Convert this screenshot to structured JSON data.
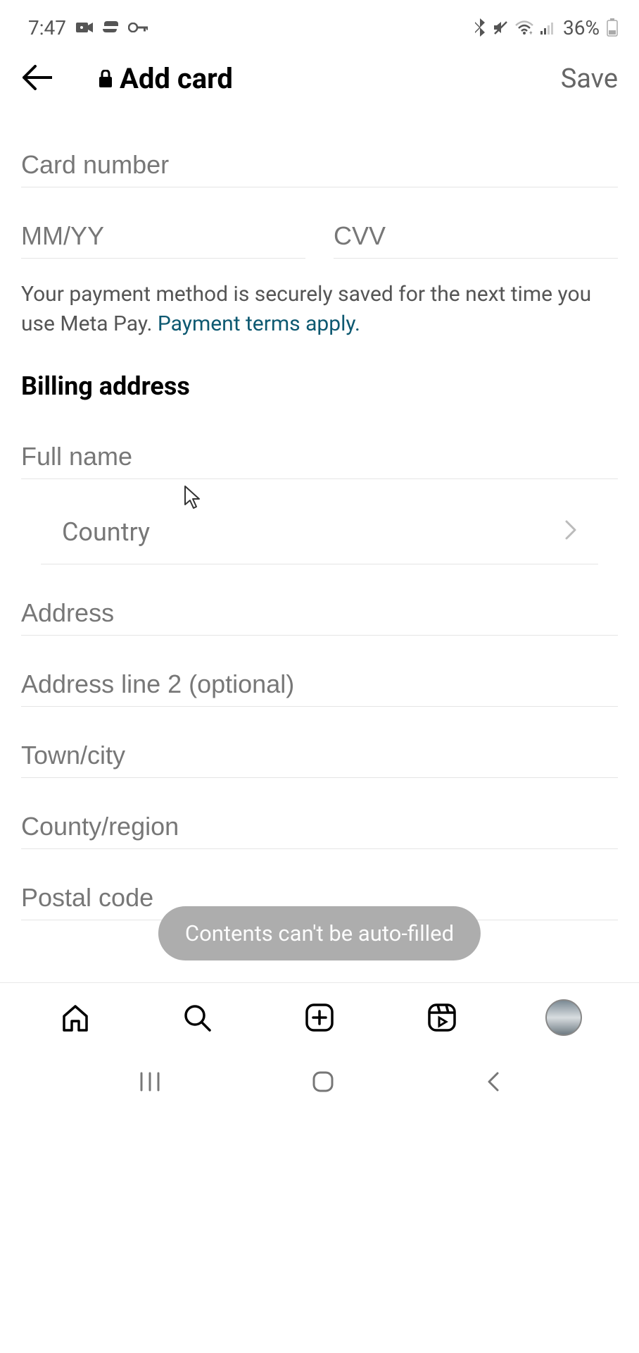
{
  "status": {
    "time": "7:47",
    "battery": "36%"
  },
  "header": {
    "title": "Add card",
    "save": "Save"
  },
  "fields": {
    "card_number_ph": "Card number",
    "expiry_ph": "MM/YY",
    "cvv_ph": "CVV",
    "full_name_ph": "Full name",
    "country_label": "Country",
    "address_ph": "Address",
    "address2_ph": "Address line 2 (optional)",
    "town_ph": "Town/city",
    "county_ph": "County/region",
    "postal_ph": "Postal code"
  },
  "info": {
    "text": "Your payment method is securely saved for the next time you use Meta Pay. ",
    "link": "Payment terms apply."
  },
  "section": {
    "billing": "Billing address"
  },
  "toast": {
    "text": "Contents can't be auto-filled"
  }
}
